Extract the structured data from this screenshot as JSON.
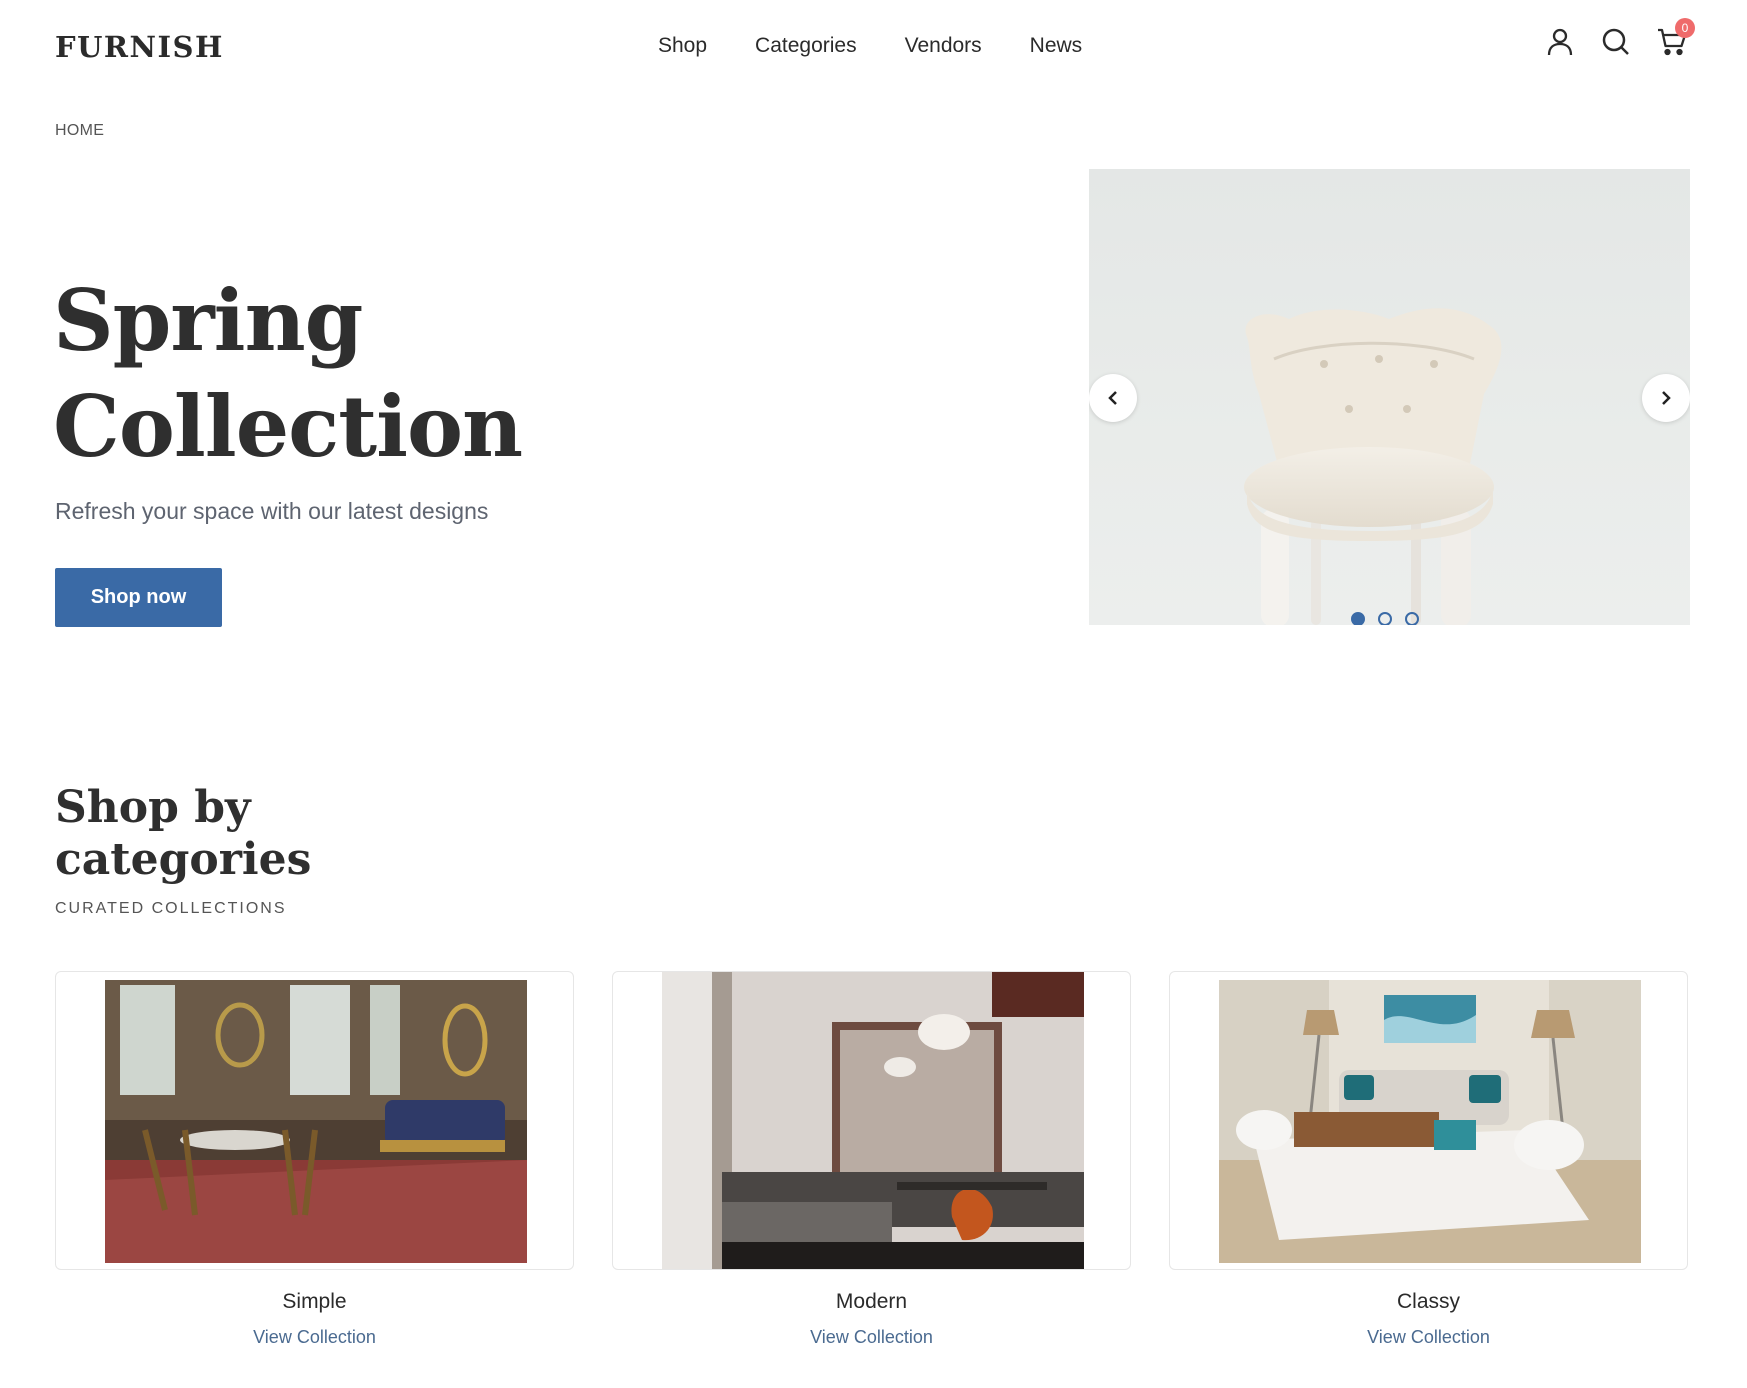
{
  "header": {
    "logo": "FURNISH",
    "nav": [
      "Shop",
      "Categories",
      "Vendors",
      "News"
    ],
    "cart_count": "0",
    "icons": [
      "user-icon",
      "search-icon",
      "cart-icon"
    ]
  },
  "breadcrumb": "HOME",
  "hero": {
    "title_line1": "Spring",
    "title_line2": "Collection",
    "subtitle": "Refresh your space with our latest designs",
    "cta": "Shop now",
    "carousel": {
      "slides": 3,
      "active_slide": 1,
      "prev_icon": "chevron-left-icon",
      "next_icon": "chevron-right-icon"
    }
  },
  "categories": {
    "title_line1": "Shop by",
    "title_line2": "categories",
    "subtitle": "CURATED COLLECTIONS",
    "items": [
      {
        "name": "Simple",
        "link": "View Collection"
      },
      {
        "name": "Modern",
        "link": "View Collection"
      },
      {
        "name": "Classy",
        "link": "View Collection"
      }
    ]
  },
  "colors": {
    "accent": "#3a6aa6",
    "badge": "#ef6b6b",
    "link": "#4a6a90"
  }
}
